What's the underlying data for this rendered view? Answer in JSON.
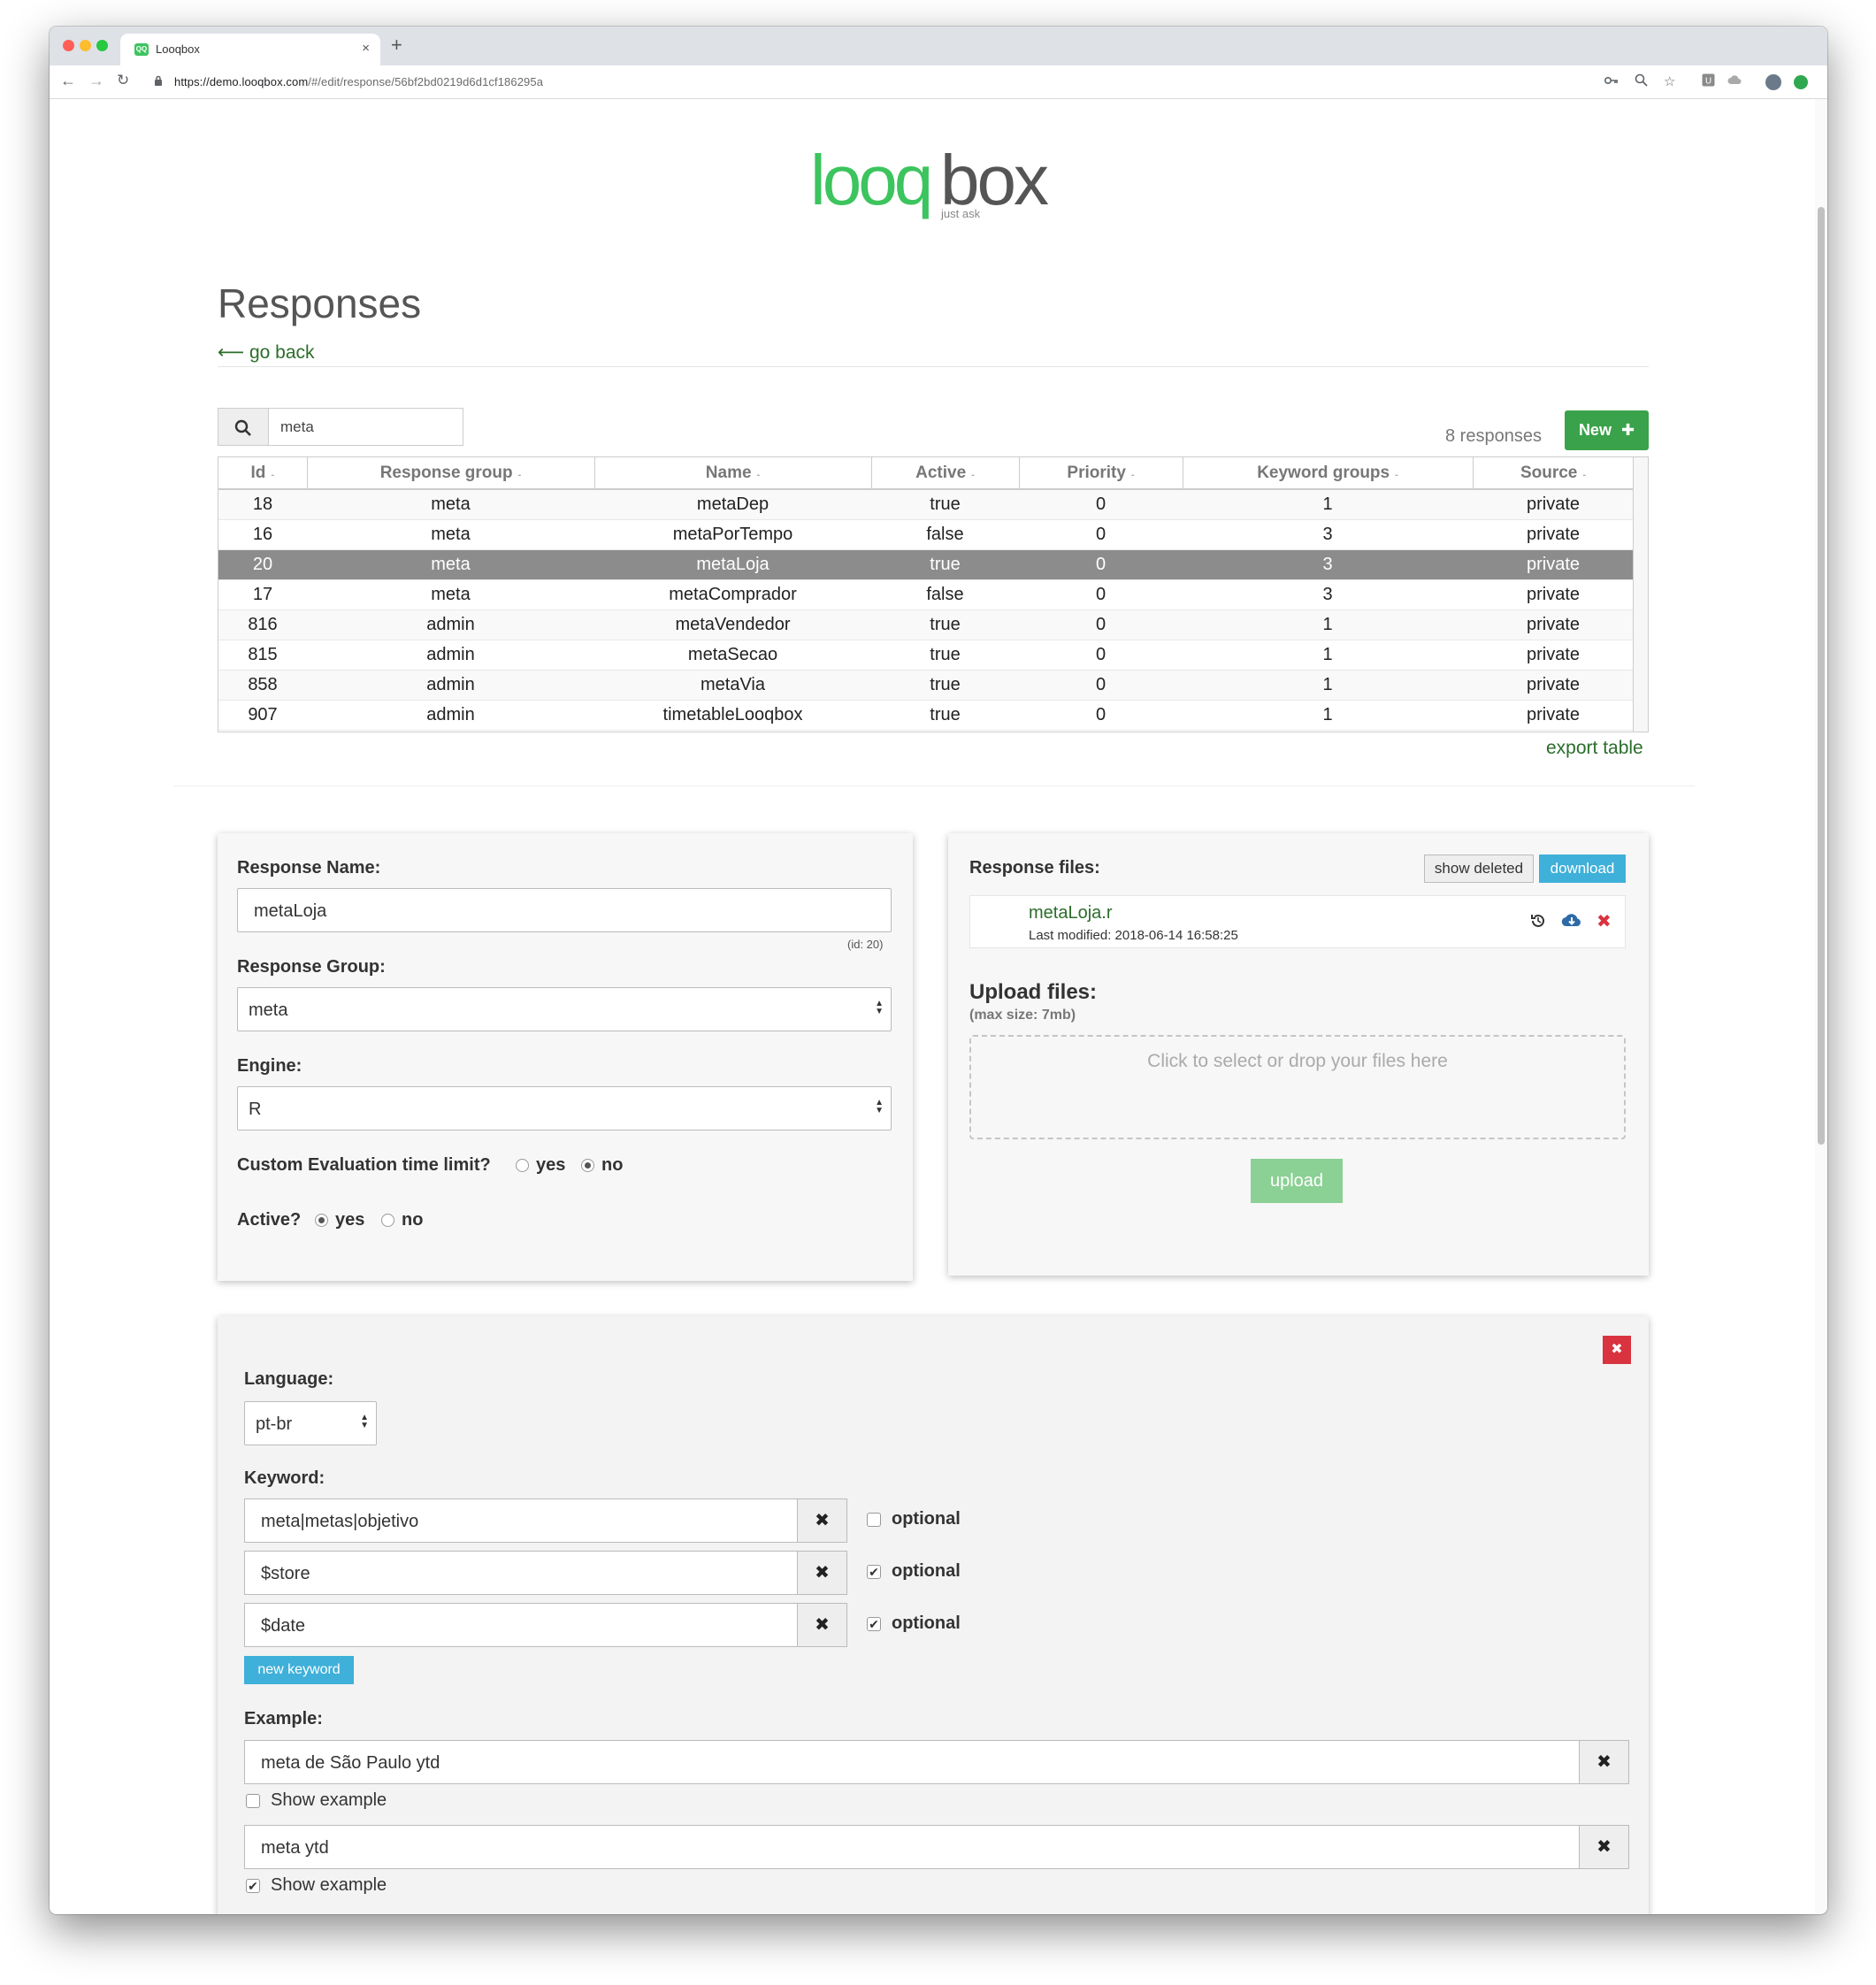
{
  "browser": {
    "tab_title": "Looqbox",
    "tab_favicon_text": "QQ",
    "url_host": "https://demo.looqbox.com",
    "url_path": "/#/edit/response/56bf2bd0219d6d1cf186295a"
  },
  "logo": {
    "part1": "looq",
    "part2": "box",
    "tagline": "just ask"
  },
  "page": {
    "title": "Responses",
    "go_back": "go back"
  },
  "search": {
    "value": "meta"
  },
  "responses_count": "8 responses",
  "new_button": "New",
  "export_link": "export table",
  "table": {
    "columns": [
      "Id",
      "Response group",
      "Name",
      "Active",
      "Priority",
      "Keyword groups",
      "Source"
    ],
    "rows": [
      [
        "18",
        "meta",
        "metaDep",
        "true",
        "0",
        "1",
        "private"
      ],
      [
        "16",
        "meta",
        "metaPorTempo",
        "false",
        "0",
        "3",
        "private"
      ],
      [
        "20",
        "meta",
        "metaLoja",
        "true",
        "0",
        "3",
        "private"
      ],
      [
        "17",
        "meta",
        "metaComprador",
        "false",
        "0",
        "3",
        "private"
      ],
      [
        "816",
        "admin",
        "metaVendedor",
        "true",
        "0",
        "1",
        "private"
      ],
      [
        "815",
        "admin",
        "metaSecao",
        "true",
        "0",
        "1",
        "private"
      ],
      [
        "858",
        "admin",
        "metaVia",
        "true",
        "0",
        "1",
        "private"
      ],
      [
        "907",
        "admin",
        "timetableLooqbox",
        "true",
        "0",
        "1",
        "private"
      ]
    ],
    "selected_row": 2
  },
  "response_form": {
    "name_label": "Response Name:",
    "name_value": "metaLoja",
    "id_note": "(id: 20)",
    "group_label": "Response Group:",
    "group_value": "meta",
    "engine_label": "Engine:",
    "engine_value": "R",
    "time_limit_label": "Custom Evaluation time limit?",
    "time_limit_yes": "yes",
    "time_limit_no": "no",
    "active_label": "Active?",
    "active_yes": "yes",
    "active_no": "no"
  },
  "files_panel": {
    "label": "Response files:",
    "show_deleted": "show deleted",
    "download": "download",
    "file_name": "metaLoja.r",
    "file_modified": "Last modified: 2018-06-14 16:58:25",
    "upload_label": "Upload files:",
    "upload_max": "(max size: 7mb)",
    "drop_text": "Click to select or drop your files here",
    "upload_button": "upload"
  },
  "keyword_panel": {
    "language_label": "Language:",
    "language_value": "pt-br",
    "keyword_label": "Keyword:",
    "keywords": [
      {
        "value": "meta|metas|objetivo",
        "optional": false
      },
      {
        "value": "$store",
        "optional": true
      },
      {
        "value": "$date",
        "optional": true
      }
    ],
    "optional_label": "optional",
    "new_keyword": "new keyword",
    "example_label": "Example:",
    "examples": [
      {
        "value": "meta de São Paulo ytd",
        "show": false
      },
      {
        "value": "meta ytd",
        "show": true
      }
    ],
    "show_example_label": "Show example"
  },
  "colors": {
    "brand_green": "#3cc45e",
    "link_green": "#2b6d2b",
    "button_green": "#3aa24a",
    "info_blue": "#3fb0d9",
    "danger_red": "#d9333f",
    "selected_row": "#8c8c8c"
  }
}
